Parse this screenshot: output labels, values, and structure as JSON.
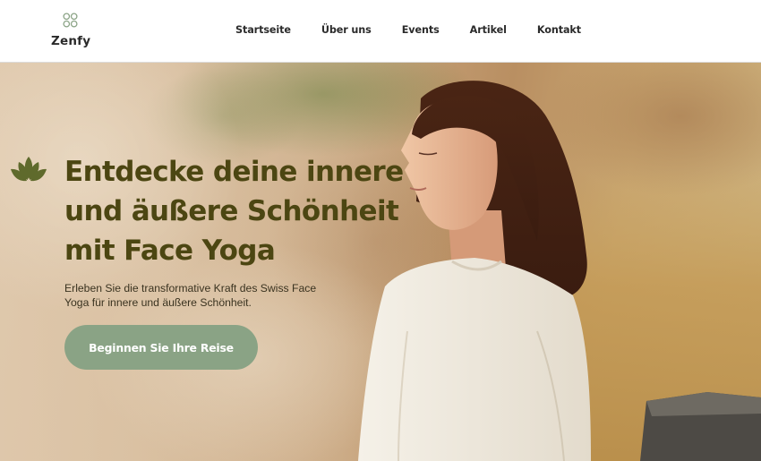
{
  "brand": {
    "name": "Zenfy",
    "logo_icon": "four-circles-icon",
    "accent_color": "#8aa385",
    "headline_color": "#4c4612"
  },
  "nav": {
    "items": [
      {
        "label": "Startseite"
      },
      {
        "label": "Über uns"
      },
      {
        "label": "Events"
      },
      {
        "label": "Artikel"
      },
      {
        "label": "Kontakt"
      }
    ]
  },
  "hero": {
    "icon": "lotus-icon",
    "headline": "Entdecke deine innere und äußere Schönheit mit Face Yoga",
    "subtext": "Erleben Sie die transformative Kraft des Swiss Face Yoga für innere und äußere Schönheit.",
    "cta_label": "Beginnen Sie Ihre Reise",
    "background_image": "woman-in-white-shirt-outdoors-photo"
  }
}
